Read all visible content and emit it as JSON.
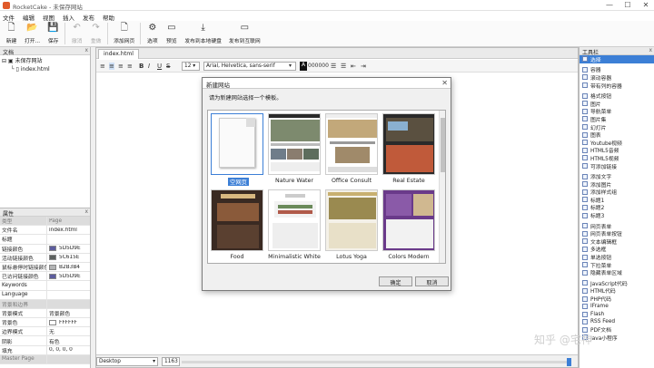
{
  "window": {
    "title": "RocketCake - 未保存网站",
    "minimize": "—",
    "maximize": "☐",
    "close": "✕"
  },
  "menu": [
    "文件",
    "编辑",
    "视图",
    "插入",
    "发布",
    "帮助"
  ],
  "toolbar": [
    {
      "label": "新建",
      "icon": "new-file-icon",
      "glyph": "🗋",
      "disabled": false
    },
    {
      "label": "打开...",
      "icon": "open-folder-icon",
      "glyph": "📂",
      "disabled": false
    },
    {
      "label": "保存",
      "icon": "save-icon",
      "glyph": "💾",
      "disabled": false
    },
    {
      "label": "撤消",
      "icon": "undo-icon",
      "glyph": "↶",
      "disabled": true
    },
    {
      "label": "重做",
      "icon": "redo-icon",
      "glyph": "↷",
      "disabled": true
    },
    {
      "label": "添加网页",
      "icon": "add-page-icon",
      "glyph": "🗋",
      "disabled": false
    },
    {
      "label": "选项",
      "icon": "gear-icon",
      "glyph": "⚙",
      "disabled": false
    },
    {
      "label": "预览",
      "icon": "preview-icon",
      "glyph": "▭",
      "disabled": false
    },
    {
      "label": "发布到本地硬盘",
      "icon": "publish-disk-icon",
      "glyph": "⤓",
      "disabled": false
    },
    {
      "label": "发布到互联网",
      "icon": "publish-web-icon",
      "glyph": "▭",
      "disabled": false
    }
  ],
  "files": {
    "title": "文档",
    "close": "x",
    "root": "未保存网站",
    "page": "index.html"
  },
  "props": {
    "title": "属性",
    "close": "x",
    "rows": [
      {
        "k": "类型",
        "v": "Page",
        "grp": true
      },
      {
        "k": "文件名",
        "v": "index.html"
      },
      {
        "k": "标题",
        "v": ""
      },
      {
        "k": "链接颜色",
        "v": "5D5D9E",
        "color": "#5d5d9e"
      },
      {
        "k": "活动链接颜色",
        "v": "5C615E",
        "color": "#5c615e"
      },
      {
        "k": "鼠标悬停时链接颜色",
        "v": "B2B3B4",
        "color": "#b2b3b4"
      },
      {
        "k": "已访问链接颜色",
        "v": "5D5D9E",
        "color": "#5d5d9e"
      },
      {
        "k": "Keywords",
        "v": ""
      },
      {
        "k": "Language",
        "v": ""
      },
      {
        "k": "背景和边界",
        "v": "",
        "grp": true
      },
      {
        "k": "背景模式",
        "v": "背景颜色"
      },
      {
        "k": "背景色",
        "v": "FFFFFF",
        "color": "#ffffff"
      },
      {
        "k": "边界模式",
        "v": "无"
      },
      {
        "k": "阴影",
        "v": "有色"
      },
      {
        "k": "填充",
        "v": "0, 0, 0, 0"
      },
      {
        "k": "Master Page",
        "v": "",
        "grp": true
      }
    ]
  },
  "editor": {
    "tab": "index.html",
    "font_size": "12",
    "font_family": "Arial, Helvetica, sans-serif",
    "color_value": "000000",
    "color_btn": "A",
    "view": "Desktop",
    "width": "1163"
  },
  "format_buttons": [
    "≡",
    "≡",
    "≡",
    "≡",
    "B",
    "I",
    "U",
    "S"
  ],
  "dialog": {
    "title": "新建网站",
    "close": "✕",
    "prompt": "请为新建网站选择一个模板。",
    "ok": "确定",
    "cancel": "取消",
    "templates": [
      "空网页",
      "Nature Water",
      "Office Consult",
      "Real Estate",
      "Food",
      "Minimalistic White",
      "Lotus Yoga",
      "Colors Modern"
    ],
    "selected": "空网页"
  },
  "toolbox": {
    "title": "工具栏",
    "close": "x",
    "groups": [
      [
        "选择"
      ],
      [
        "容器",
        "滚动容器",
        "带有列的容器"
      ],
      [
        "格式按钮",
        "图片",
        "导航菜单",
        "图片集",
        "幻灯片",
        "图表",
        "Youtube视频",
        "HTML5音频",
        "HTML5视频",
        "可添加链接"
      ],
      [
        "添加文字",
        "添加图片",
        "添加样式组",
        "标题1",
        "标题2",
        "标题3"
      ],
      [
        "网页表单",
        "网页表单按钮",
        "文本编辑框",
        "多选框",
        "单选按钮",
        "下拉菜单",
        "隐藏表单区域"
      ],
      [
        "JavaScript代码",
        "HTML代码",
        "PHP代码",
        "IFrame",
        "Flash",
        "RSS Feed",
        "PDF文档",
        "Java小程序"
      ]
    ]
  },
  "watermark": "知乎 @宅神"
}
